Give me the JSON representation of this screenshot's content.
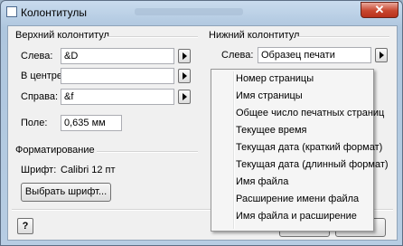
{
  "window": {
    "title": "Колонтитулы",
    "close_glyph": "✕"
  },
  "header": {
    "group_label": "Верхний колонтитул",
    "left_label": "Слева:",
    "left_value": "&D",
    "center_label": "В центре:",
    "center_value": "",
    "right_label": "Справа:",
    "right_value": "&f",
    "field_label": "Поле:",
    "field_value": "0,635 мм"
  },
  "footer": {
    "group_label": "Нижний колонтитул",
    "left_label": "Слева:",
    "left_value": "Образец печати"
  },
  "formatting": {
    "group_label": "Форматирование",
    "font_label": "Шрифт:",
    "font_value": "Calibri 12 пт",
    "choose_font_button": "Выбрать шрифт..."
  },
  "help_button": "?",
  "context_menu": {
    "items": [
      "Номер страницы",
      "Имя страницы",
      "Общее число печатных страниц",
      "Текущее время",
      "Текущая дата (краткий формат)",
      "Текущая дата (длинный формат)",
      "Имя файла",
      "Расширение имени файла",
      "Имя файла и расширение"
    ]
  }
}
